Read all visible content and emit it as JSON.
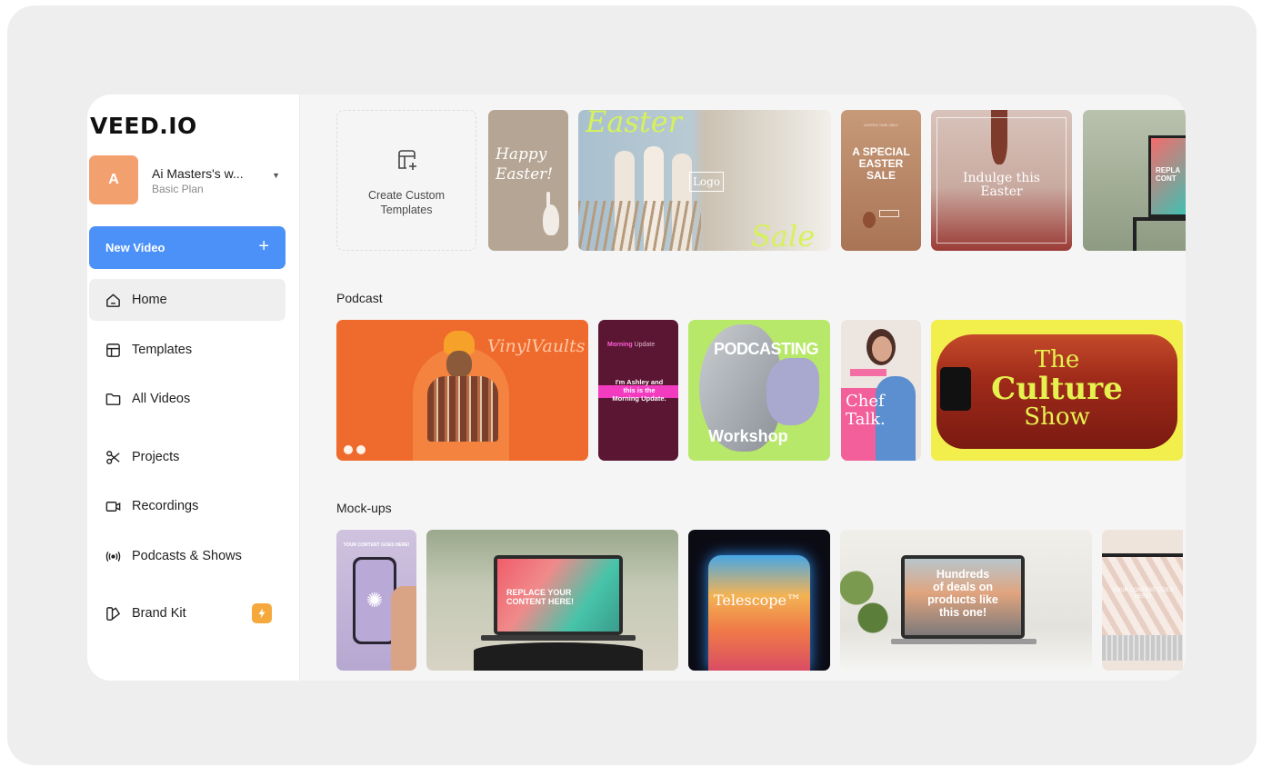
{
  "app": {
    "logo": "VEED.IO"
  },
  "workspace": {
    "avatar_letter": "A",
    "name": "Ai Masters's w...",
    "plan": "Basic Plan"
  },
  "sidebar": {
    "new_video_label": "New Video",
    "items": [
      {
        "label": "Home",
        "icon": "home-icon"
      },
      {
        "label": "Templates",
        "icon": "templates-icon"
      },
      {
        "label": "All Videos",
        "icon": "folder-icon"
      },
      {
        "label": "Projects",
        "icon": "scissors-icon"
      },
      {
        "label": "Recordings",
        "icon": "camera-icon"
      },
      {
        "label": "Podcasts & Shows",
        "icon": "broadcast-icon"
      },
      {
        "label": "Brand Kit",
        "icon": "brand-kit-icon"
      }
    ]
  },
  "create_template": {
    "label_line1": "Create Custom",
    "label_line2": "Templates"
  },
  "sections": {
    "podcast": "Podcast",
    "mockups": "Mock-ups"
  },
  "thumbs": {
    "happy_easter_1": "Happy",
    "happy_easter_2": "Easter!",
    "easter_title": "Easter",
    "easter_logo": "Logo",
    "easter_sale": "Sale",
    "special_small": "LIMITED TIME ONLY",
    "special_1": "A SPECIAL",
    "special_2": "EASTER",
    "special_3": "SALE",
    "indulge_1": "Indulge this",
    "indulge_2": "Easter",
    "replace_partial": "REPLA\nCONT",
    "vinyl": "VinylVaults",
    "morning_title": "Morning",
    "morning_sub": "Update",
    "morning_body": "I'm Ashley and this is the Morning Update.",
    "podcasting": "PODCASTING",
    "workshop": "Workshop",
    "chef": "Chef",
    "talk": "Talk.",
    "culture_1": "The",
    "culture_2": "Culture",
    "culture_3": "Show",
    "phone_caption": "YOUR CONTENT GOES HERE!",
    "replace_1": "REPLACE YOUR",
    "replace_2": "CONTENT HERE!",
    "telescope": "Telescope™",
    "hundreds_1": "Hundreds",
    "hundreds_2": "of deals on",
    "hundreds_3": "products like",
    "hundreds_4": "this one!",
    "your_content": "YOUR CONTENT GOES HERE!"
  },
  "colors": {
    "accent": "#4b91f7",
    "avatar": "#f3a06f",
    "badge": "#f5a93c"
  }
}
